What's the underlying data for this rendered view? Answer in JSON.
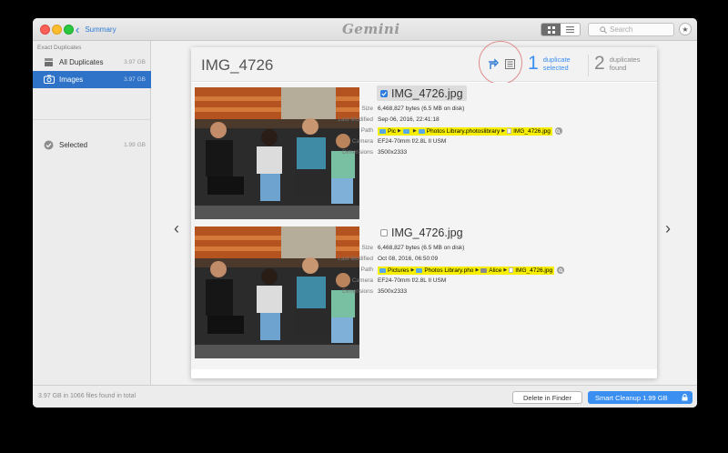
{
  "topbar": {
    "back_label": "Summary",
    "app_logo": "Gemini",
    "search_placeholder": "Search"
  },
  "sidebar": {
    "header": "Exact Duplicates",
    "items": [
      {
        "label": "All Duplicates",
        "size": "3.97 GB",
        "icon": "stack-icon"
      },
      {
        "label": "Images",
        "size": "3.97 GB",
        "icon": "camera-icon",
        "active": true
      },
      {
        "label": "Selected",
        "size": "1.99 GB",
        "icon": "check-circle-icon"
      }
    ]
  },
  "group": {
    "title": "IMG_4726",
    "duplicate_selected_count": "1",
    "duplicate_selected_label_1": "duplicate",
    "duplicate_selected_label_2": "selected",
    "duplicates_found_count": "2",
    "duplicates_found_label_1": "duplicates",
    "duplicates_found_label_2": "found"
  },
  "labels": {
    "size": "Size",
    "last_modified": "Last Modified",
    "path": "Path",
    "camera": "Camera",
    "dimensions": "Dimensions"
  },
  "files": [
    {
      "name": "IMG_4726.jpg",
      "checked": true,
      "size": "6,468,827 bytes (6.5 MB on disk)",
      "modified": "Sep 06, 2016, 22:41:18",
      "path": [
        "Pic",
        "",
        "Photos Library.photoslibrary",
        "IMG_4726.jpg"
      ],
      "camera": "EF24-70mm f/2.8L II USM",
      "dimensions": "3500x2333"
    },
    {
      "name": "IMG_4726.jpg",
      "checked": false,
      "size": "6,468,827 bytes (6.5 MB on disk)",
      "modified": "Oct 08, 2016, 06:50:09",
      "path": [
        "Pictures",
        "Photos Library.pho",
        "Alice",
        "IMG_4726.jpg"
      ],
      "camera": "EF24-70mm f/2.8L II USM",
      "dimensions": "3500x2333"
    }
  ],
  "footer": {
    "status": "3.97 GB in 1066 files found in total",
    "delete_label": "Delete in Finder",
    "cleanup_label": "Smart Cleanup 1.99 GB"
  },
  "colors": {
    "accent": "#2e73c8",
    "button_blue": "#3a8ff0",
    "path_highlight": "#f8ef00"
  }
}
